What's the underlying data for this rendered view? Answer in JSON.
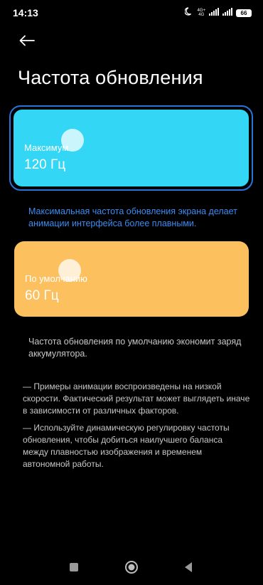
{
  "status_bar": {
    "time": "14:13",
    "network_top": "4G+",
    "network_bottom": "4G",
    "battery": "66"
  },
  "header": {
    "title": "Частота обновления"
  },
  "options": [
    {
      "label": "Максимум",
      "value": "120 Гц",
      "selected": true,
      "color": "#33d7f5"
    },
    {
      "label": "По умолчанию",
      "value": "60 Гц",
      "selected": false,
      "color": "#fcc05f"
    }
  ],
  "descriptions": {
    "max": "Максимальная частота обновления экрана делает анимации интерфейса более плавными.",
    "default": "Частота обновления по умолчанию экономит заряд аккумулятора.",
    "note_1": "— Примеры анимации воспроизведены на низкой скорости. Фактический результат может выглядеть иначе в зависимости от различных факторов.",
    "note_2": "— Используйте динамическую регулировку частоты обновления, чтобы добиться наилучшего баланса между плавностью изображения и временем автономной работы."
  },
  "colors": {
    "accent": "#3b8cf0",
    "selection_border": "#2a74d9",
    "background": "#000000"
  },
  "icons": {
    "back": "arrow-left-icon",
    "moon": "moon-icon",
    "signal": "signal-icon",
    "battery": "battery-icon",
    "nav_recents": "square-icon",
    "nav_home": "circle-icon",
    "nav_back": "triangle-left-icon"
  }
}
